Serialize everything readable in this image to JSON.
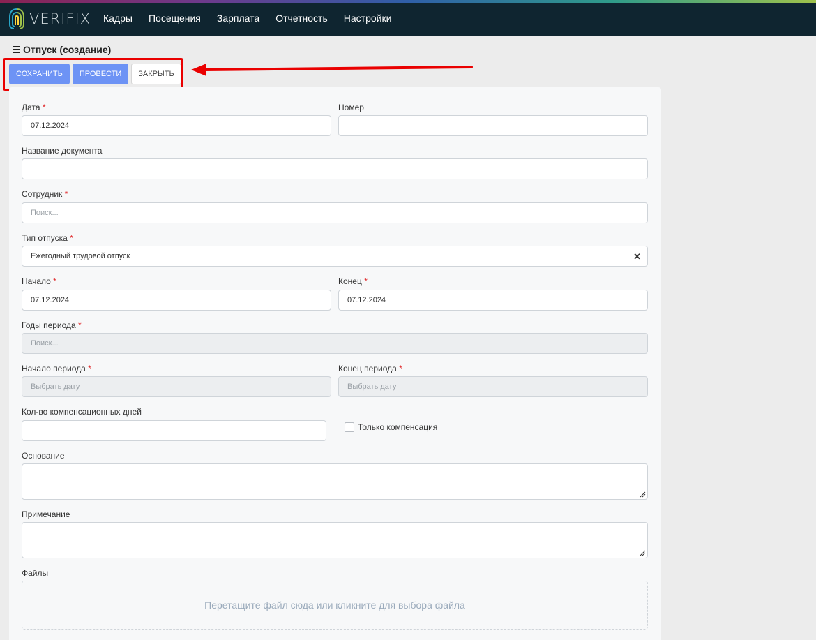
{
  "app": {
    "logo_text": "VERIFIX"
  },
  "nav": [
    "Кадры",
    "Посещения",
    "Зарплата",
    "Отчетность",
    "Настройки"
  ],
  "page": {
    "title": "Отпуск (создание)"
  },
  "toolbar": {
    "save_label": "СОХРАНИТЬ",
    "post_label": "ПРОВЕСТИ",
    "close_label": "ЗАКРЫТЬ"
  },
  "form": {
    "date": {
      "label": "Дата",
      "value": "07.12.2024"
    },
    "number": {
      "label": "Номер",
      "value": ""
    },
    "doc_name": {
      "label": "Название документа",
      "value": ""
    },
    "employee": {
      "label": "Сотрудник",
      "placeholder": "Поиск..."
    },
    "leave_type": {
      "label": "Тип отпуска",
      "value": "Ежегодный трудовой отпуск"
    },
    "start": {
      "label": "Начало",
      "value": "07.12.2024"
    },
    "end": {
      "label": "Конец",
      "value": "07.12.2024"
    },
    "period_years": {
      "label": "Годы периода",
      "placeholder": "Поиск..."
    },
    "period_start": {
      "label": "Начало периода",
      "placeholder": "Выбрать дату"
    },
    "period_end": {
      "label": "Конец периода",
      "placeholder": "Выбрать дату"
    },
    "comp_days": {
      "label": "Кол-во компенсационных дней",
      "value": ""
    },
    "only_comp": {
      "label": "Только компенсация",
      "checked": false
    },
    "basis": {
      "label": "Основание",
      "value": ""
    },
    "note": {
      "label": "Примечание",
      "value": ""
    },
    "files": {
      "label": "Файлы",
      "dropzone_text": "Перетащите файл сюда или кликните для выбора файла"
    },
    "required_mark": "*"
  },
  "colors": {
    "primary": "#6d93f5",
    "header_bg": "#0f2530",
    "required": "#e0292b",
    "annotation": "#ea0000"
  }
}
